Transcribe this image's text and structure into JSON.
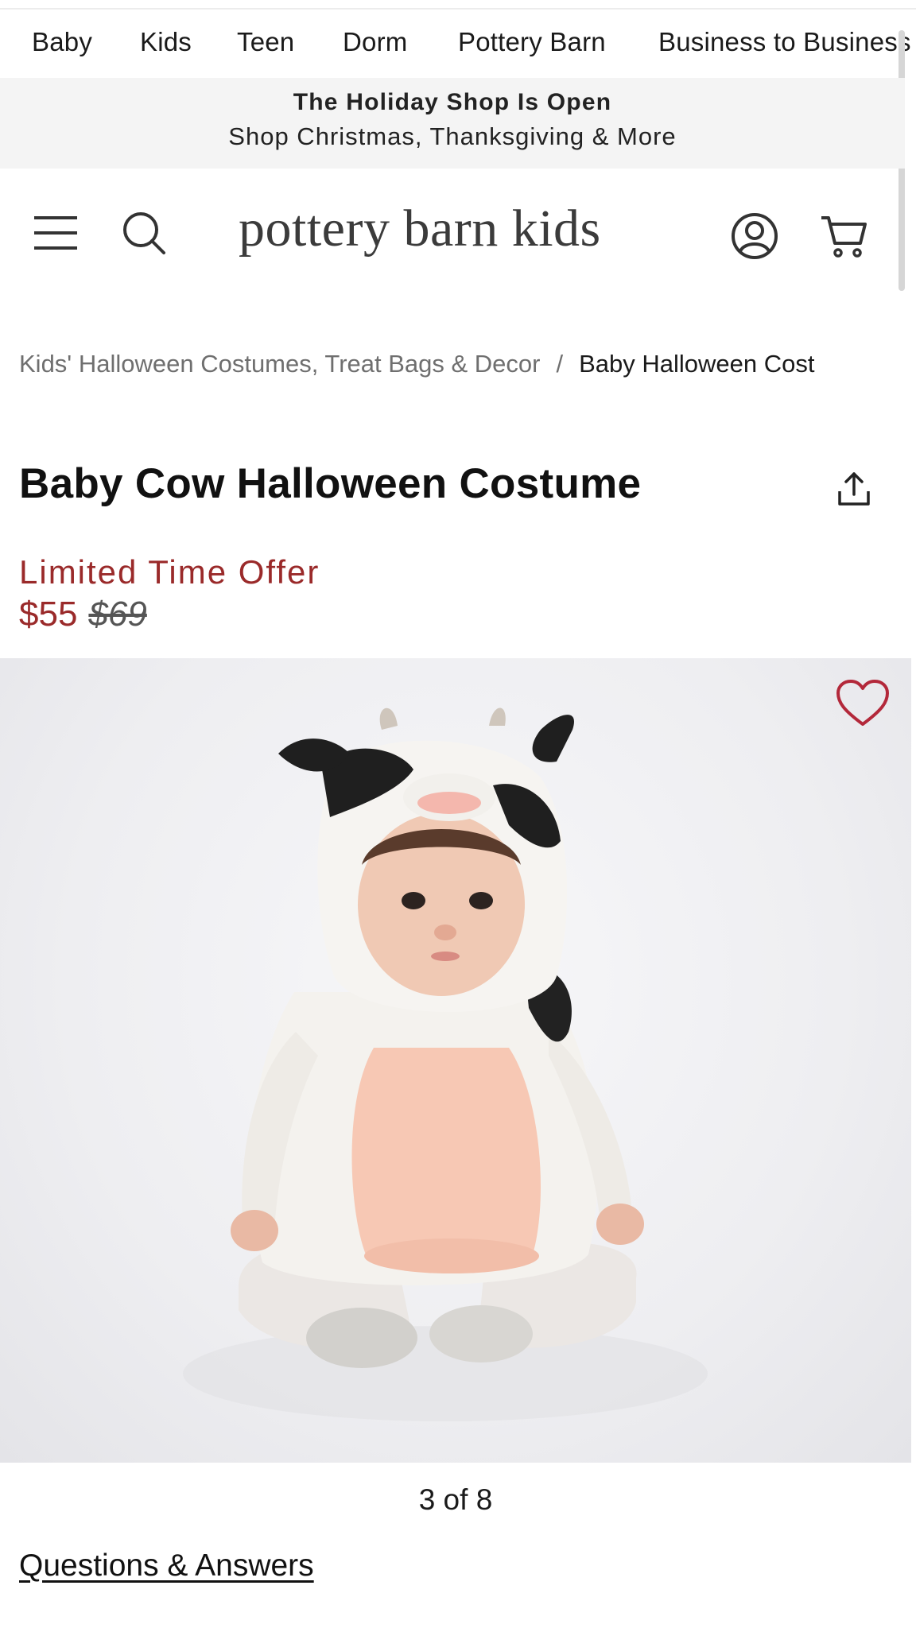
{
  "brand_nav": [
    {
      "label": "Baby"
    },
    {
      "label": "Kids"
    },
    {
      "label": "Teen"
    },
    {
      "label": "Dorm"
    },
    {
      "label": "Pottery Barn"
    },
    {
      "label": "Business to Business"
    }
  ],
  "promo": {
    "line1": "The Holiday Shop Is Open",
    "line2": "Shop Christmas, Thanksgiving & More"
  },
  "header": {
    "logo": "pottery barn kids",
    "icons": [
      "menu-icon",
      "search-icon",
      "account-icon",
      "cart-icon"
    ]
  },
  "breadcrumb": {
    "parent": "Kids' Halloween Costumes, Treat Bags & Decor",
    "separator": "/",
    "current": "Baby Halloween Cost"
  },
  "product": {
    "title": "Baby Cow Halloween Costume",
    "offer_label": "Limited Time Offer",
    "sale_price": "$55",
    "original_price": "$69",
    "image_counter": "3 of 8",
    "image_index": 3,
    "image_total": 8
  },
  "links": {
    "qa": "Questions & Answers"
  },
  "colors": {
    "sale": "#9a2a2a",
    "promo_bg": "#f4f4f4",
    "heart": "#b3283a"
  }
}
